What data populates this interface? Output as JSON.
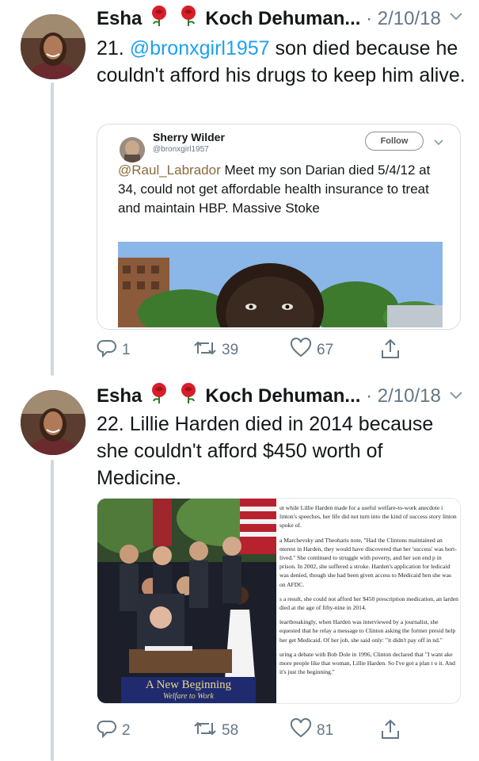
{
  "tweets": [
    {
      "author_first": "Esha",
      "author_last": "Koch Dehuman...",
      "date": "· 2/10/18",
      "text_prefix": "21. ",
      "mention": "@bronxgirl1957",
      "text_rest": " son died because he couldn't afford his drugs to keep him alive.",
      "quote": {
        "name": "Sherry Wilder",
        "handle": "@bronxgirl1957",
        "follow_label": "Follow",
        "mention": "@Raul_Labrador",
        "text": " Meet my son Darian died 5/4/12 at 34, could not get affordable health insurance to treat and maintain HBP. Massive Stoke"
      },
      "replies": "1",
      "retweets": "39",
      "likes": "67"
    },
    {
      "author_first": "Esha",
      "author_last": "Koch Dehuman...",
      "date": "· 2/10/18",
      "text": "22. Lillie Harden died in 2014 because she couldn't afford $450 worth of Medicine.",
      "media": {
        "banner_title": "A New Beginning",
        "banner_sub": "Welfare to Work",
        "article": [
          "ut while Lillie Harden made for a useful welfare-to-work anecdote i linton's speeches, her life did not turn into the kind of success story linton spoke of.",
          "a Marchevsky and Theoharis note, \"Had the Clintons maintained an nterest in Harden, they would have discovered that her 'success' was hort-lived.\" She continued to struggle with poverty, and her son end p in prison. In 2002, she suffered a stroke. Harden's application for ledicaid was denied, though she had been given access to Medicaid hen she was on AFDC.",
          "s a result, she could not afford her $450 prescription medication, an larden died at the age of fifty-nine in 2014.",
          "leartbreakingly, when Harden was interviewed by a journalist, she equested that he relay a message to Clinton asking the former presid help her get Medicaid. Of her job, she said only: \"it didn't pay off in nd.\"",
          "uring a debate with Bob Dole in 1996, Clinton declared that \"I want ake more people like that woman, Lillie Harden. So I've got a plan t o it. And it's just the beginning.\""
        ]
      },
      "replies": "2",
      "retweets": "58",
      "likes": "81"
    }
  ],
  "colors": {
    "accent": "#1da1f2",
    "muted": "#657786",
    "rose": "#d81e2a"
  },
  "icons": [
    "rose-icon",
    "chevron-down-icon",
    "reply-icon",
    "retweet-icon",
    "like-icon",
    "share-icon"
  ]
}
